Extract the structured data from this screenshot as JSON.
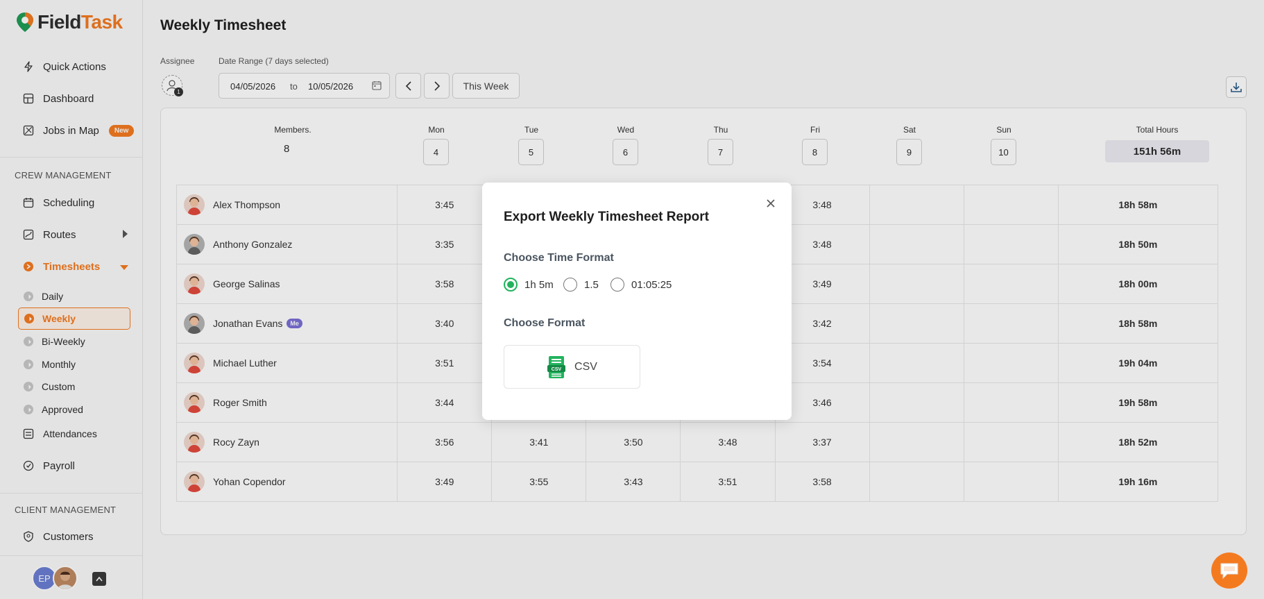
{
  "app": {
    "logo_part1": "Field",
    "logo_part2": "Task",
    "brand_color": "#f47a20"
  },
  "sidebar": {
    "quick_actions": "Quick Actions",
    "dashboard": "Dashboard",
    "jobs_in_map": "Jobs in Map",
    "new_badge": "New",
    "crew_section": "CREW MANAGEMENT",
    "scheduling": "Scheduling",
    "routes": "Routes",
    "timesheets": "Timesheets",
    "sub_items": [
      "Daily",
      "Weekly",
      "Bi-Weekly",
      "Monthly",
      "Custom",
      "Approved"
    ],
    "active_sub_item": "Weekly",
    "attendances": "Attendances",
    "payroll": "Payroll",
    "client_section": "CLIENT MANAGEMENT",
    "customers": "Customers",
    "user_initials": "EP"
  },
  "page": {
    "title": "Weekly Timesheet",
    "assignee_label": "Assignee",
    "assignee_count": "1",
    "date_range_label": "Date Range (7 days selected)",
    "date_from": "04/05/2026",
    "date_to_word": "to",
    "date_to": "10/05/2026",
    "this_week": "This Week"
  },
  "table": {
    "members_label": "Members.",
    "members_count": "8",
    "days": [
      {
        "label": "Mon",
        "num": "4"
      },
      {
        "label": "Tue",
        "num": "5"
      },
      {
        "label": "Wed",
        "num": "6"
      },
      {
        "label": "Thu",
        "num": "7"
      },
      {
        "label": "Fri",
        "num": "8"
      },
      {
        "label": "Sat",
        "num": "9"
      },
      {
        "label": "Sun",
        "num": "10"
      }
    ],
    "total_label": "Total Hours",
    "total_value": "151h 56m",
    "rows": [
      {
        "name": "Alex Thompson",
        "hours": [
          "3:45",
          "",
          "",
          "",
          "3:48",
          "",
          ""
        ],
        "total": "18h 58m"
      },
      {
        "name": "Anthony Gonzalez",
        "hours": [
          "3:35",
          "",
          "",
          "",
          "3:48",
          "",
          ""
        ],
        "total": "18h 50m"
      },
      {
        "name": "George Salinas",
        "hours": [
          "3:58",
          "",
          "",
          "",
          "3:49",
          "",
          ""
        ],
        "total": "18h 00m"
      },
      {
        "name": "Jonathan Evans",
        "badge": "Me",
        "hours": [
          "3:40",
          "",
          "",
          "",
          "3:42",
          "",
          ""
        ],
        "total": "18h 58m"
      },
      {
        "name": "Michael Luther",
        "hours": [
          "3:51",
          "",
          "",
          "",
          "3:54",
          "",
          ""
        ],
        "total": "19h 04m"
      },
      {
        "name": "Roger Smith",
        "hours": [
          "3:44",
          "",
          "",
          "",
          "3:46",
          "",
          ""
        ],
        "total": "19h 58m"
      },
      {
        "name": "Rocy Zayn",
        "hours": [
          "3:56",
          "3:41",
          "3:50",
          "3:48",
          "3:37",
          "",
          ""
        ],
        "total": "18h 52m"
      },
      {
        "name": "Yohan Copendor",
        "hours": [
          "3:49",
          "3:55",
          "3:43",
          "3:51",
          "3:58",
          "",
          ""
        ],
        "total": "19h 16m"
      }
    ]
  },
  "modal": {
    "title": "Export Weekly Timesheet Report",
    "time_format_label": "Choose Time Format",
    "time_options": [
      "1h 5m",
      "1.5",
      "01:05:25"
    ],
    "selected_time_option": "1h 5m",
    "format_label": "Choose Format",
    "csv_label": "CSV",
    "csv_icon_text": "CSV",
    "accent_color": "#22b35e"
  }
}
